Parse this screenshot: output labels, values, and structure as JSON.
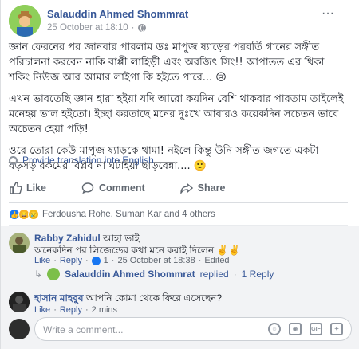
{
  "post": {
    "author": "Salauddin Ahmed Shommrat",
    "time": "25 October at 18:10",
    "separator": "·",
    "more": "···",
    "paragraphs": [
      "জ্ঞান ফেরনের পর জানবার পারলাম ডঃ মাপুজ ষ্যাড়ের পরবর্তি গানের সঙ্গীত পরিচালনা করবেন নাকি বাপ্পী লাহিড়ী এবং অরজিৎ সিং!! আপাতত এর থিকা শকিং নিউজ আর আমার লাইগা কি হইতে পারে... 😢",
      "এখন ভাবতেছি জ্ঞান হারা হইয়া যদি আরো কয়দিন বেশি থাকবার পারতাম তাইলেই মনেহয় ভাল হইতো। ইচ্ছা করতাছে মনের দুঃখে আবারও কয়েকদিন সচেতন ভাবে অচেতন হেয়া পড়ি!",
      "ওরে তোরা কেউ মাপুজ ষ্যাড়কে থামা! নইলে কিন্তু উনি সঙ্গীত জগতে একটা বড়সড় রকমের বিপ্লব না ঘটাইয়া ছাড়বেন্না.... 🙂"
    ],
    "translate_label": "Provide translation into English"
  },
  "actions": {
    "like": "Like",
    "comment": "Comment",
    "share": "Share"
  },
  "reactions": {
    "summary": "Ferdousha Rohe, Suman Kar and 4 others"
  },
  "comments": [
    {
      "name": "Rabby Zahidul",
      "text_inline": "আহা ভাই",
      "text_line2": "অনেকদিন পর লিজেন্ডের কথা মনে করাই দিলেন ✌️✌️",
      "like": "Like",
      "reply": "Reply",
      "likes_count": "1",
      "time": "25 October at 18:38",
      "edited": "Edited"
    },
    {
      "name": "হাসান মাহবুব",
      "text_inline": "আপনি কোমা থেকে ফিরে এসেছেন?",
      "like": "Like",
      "reply": "Reply",
      "time": "2 mins"
    }
  ],
  "reply_thread": {
    "name": "Salauddin Ahmed Shommrat",
    "replied": "replied",
    "count": "1 Reply"
  },
  "write": {
    "placeholder": "Write a comment..."
  },
  "colors": {
    "link": "#385898",
    "muted": "#90949c",
    "like_blue": "#1877f2"
  }
}
